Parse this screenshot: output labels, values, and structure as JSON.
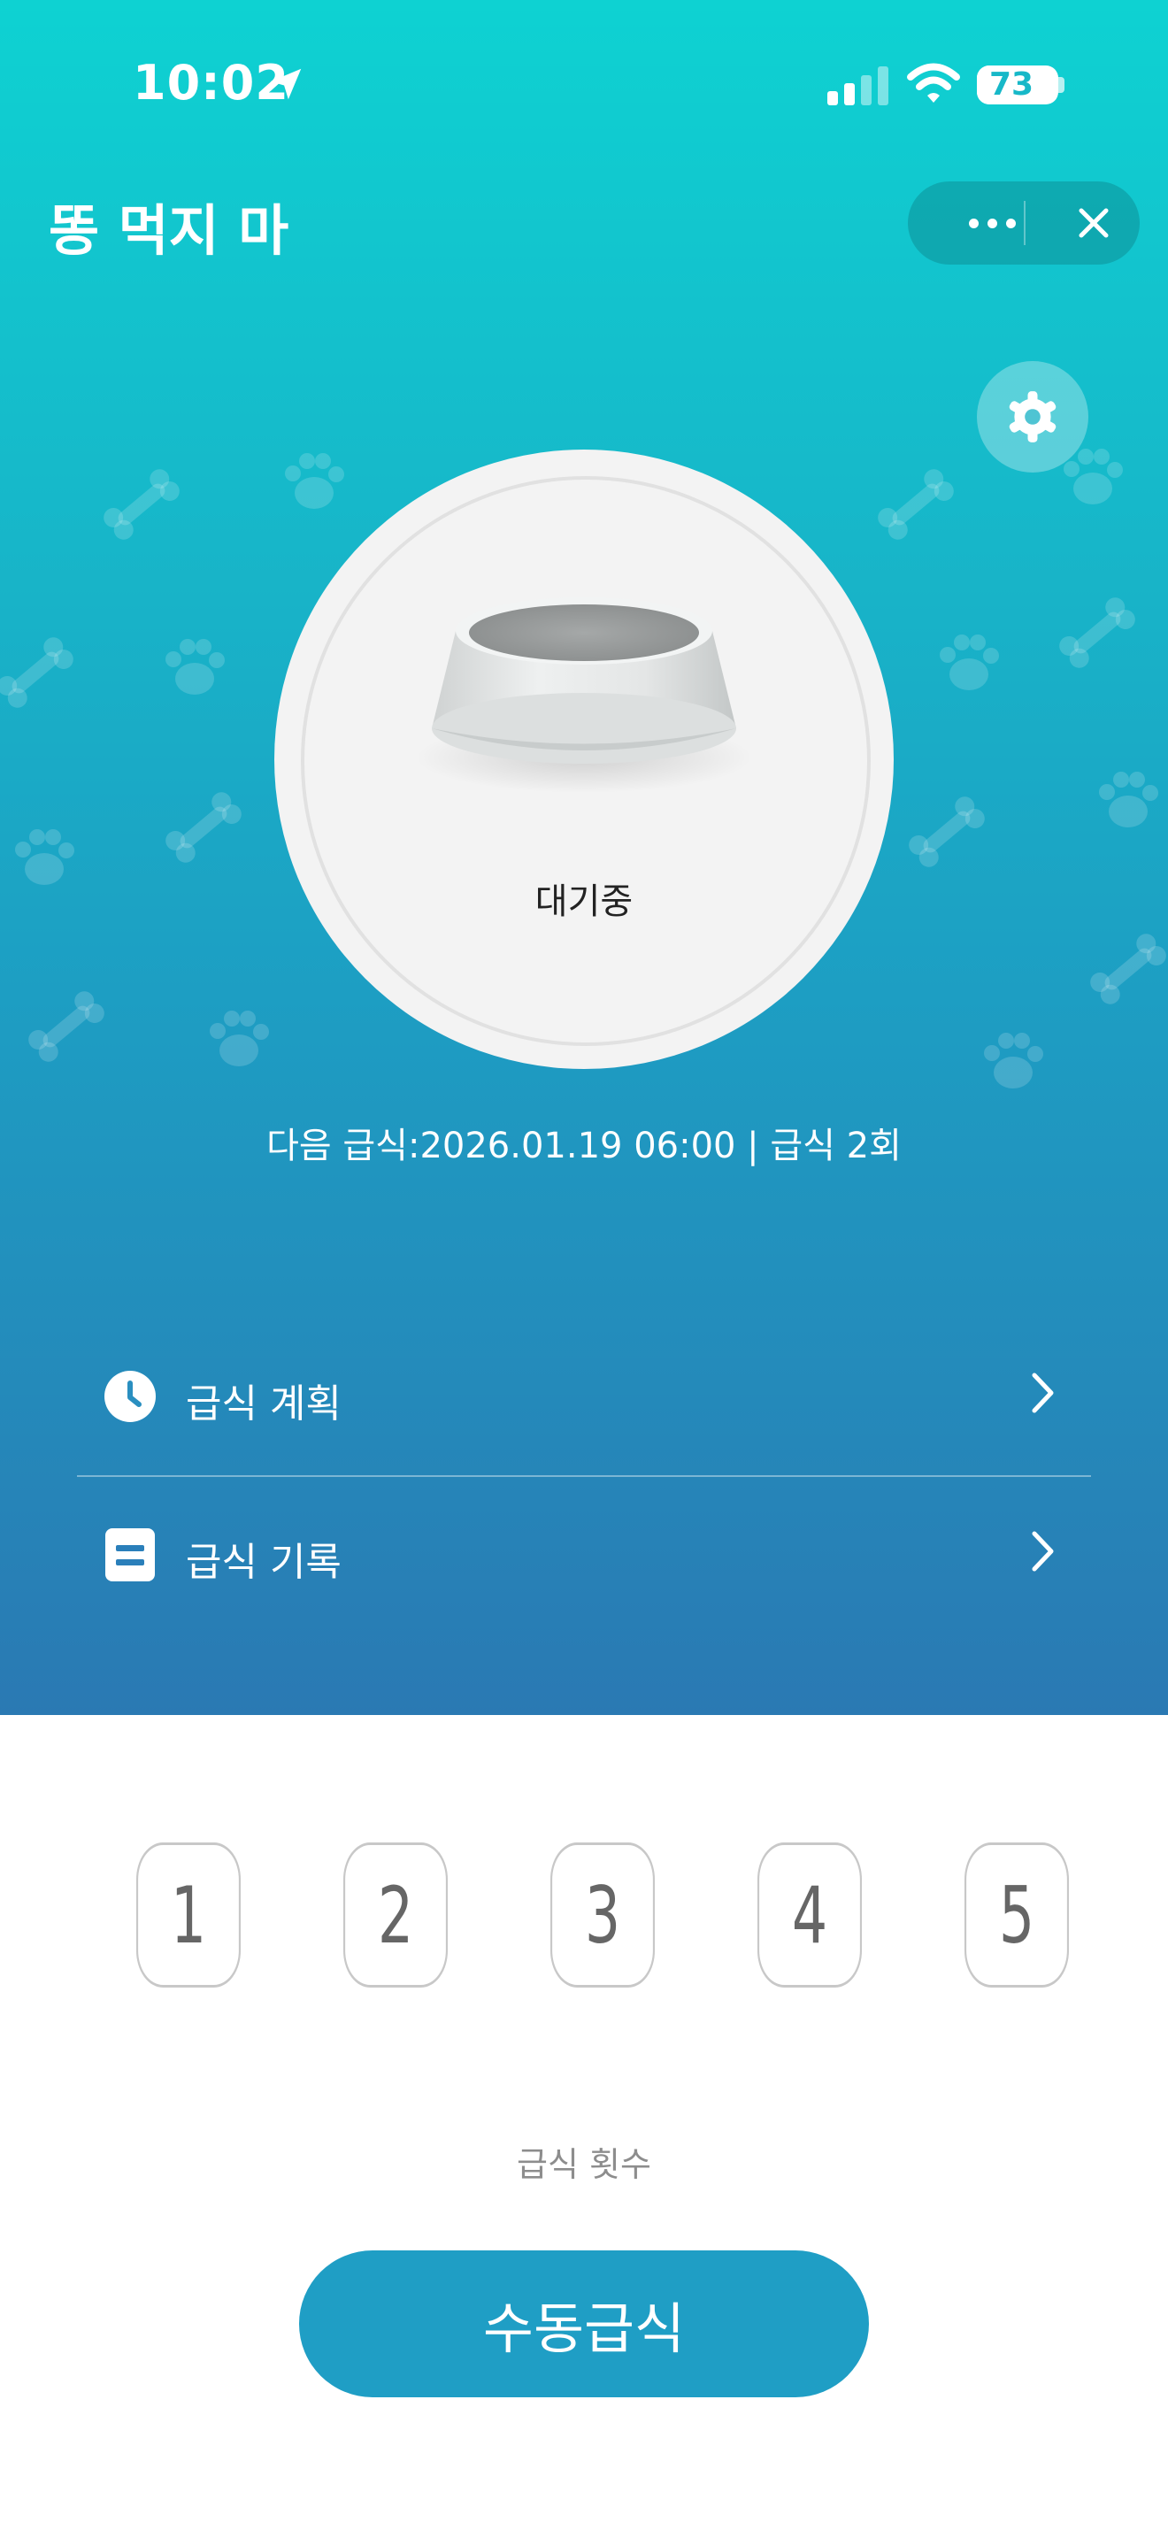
{
  "status_bar": {
    "time": "10:02",
    "battery": "73",
    "battery_level": 0.73
  },
  "header": {
    "title": "똥 먹지 마"
  },
  "feeder": {
    "status": "대기중",
    "next_feeding": "다음 급식:2026.01.19 06:00 | 급식 2회"
  },
  "menu": [
    {
      "label": "급식 계획",
      "icon": "clock-icon"
    },
    {
      "label": "급식 기록",
      "icon": "document-icon"
    }
  ],
  "portions": [
    "1",
    "2",
    "3",
    "4",
    "5"
  ],
  "portion_label": "급식 횟수",
  "manual_button": "수동급식",
  "colors": {
    "accent": "#1f9ec5",
    "gradient_top": "#0ed2d2",
    "gradient_bottom": "#2a79b3"
  }
}
